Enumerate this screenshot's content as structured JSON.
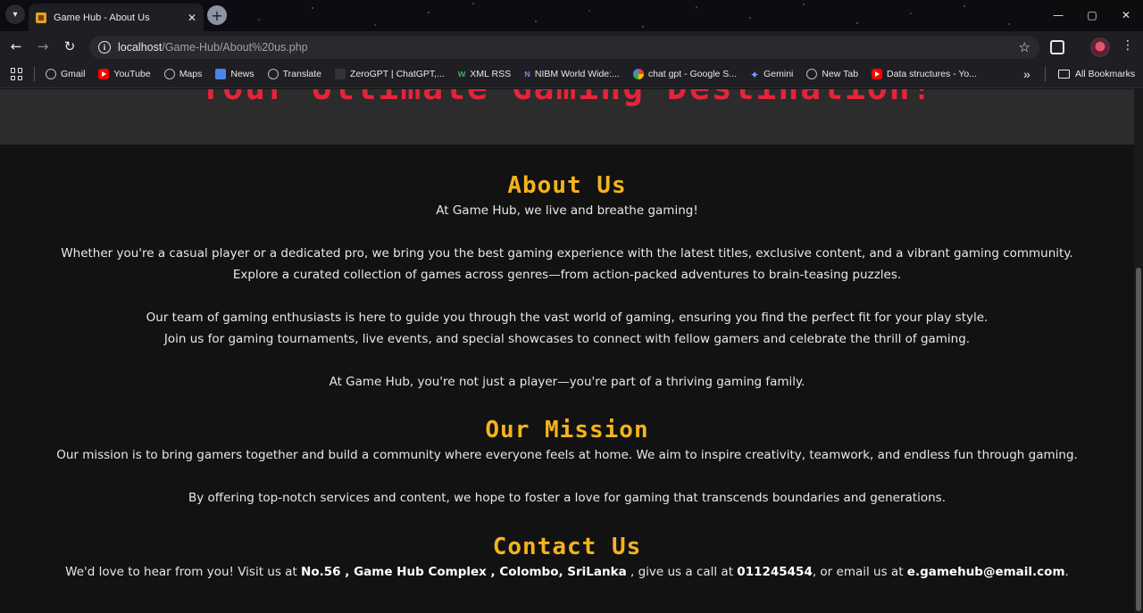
{
  "browser": {
    "tab_title": "Game Hub - About Us",
    "url_host": "localhost",
    "url_path": "/Game-Hub/About%20us.php",
    "bookmarks": [
      {
        "label": "Gmail",
        "icon": "globe-icon"
      },
      {
        "label": "YouTube",
        "icon": "youtube-icon"
      },
      {
        "label": "Maps",
        "icon": "globe-icon"
      },
      {
        "label": "News",
        "icon": "news-icon"
      },
      {
        "label": "Translate",
        "icon": "globe-icon"
      },
      {
        "label": "ZeroGPT | ChatGPT,...",
        "icon": "zerogpt-icon"
      },
      {
        "label": "XML RSS",
        "icon": "xml-icon"
      },
      {
        "label": "NIBM World Wide:...",
        "icon": "nibm-icon"
      },
      {
        "label": "chat gpt - Google S...",
        "icon": "google-icon"
      },
      {
        "label": "Gemini",
        "icon": "gemini-icon"
      },
      {
        "label": "New Tab",
        "icon": "globe-icon"
      },
      {
        "label": "Data structures - Yo...",
        "icon": "youtube-icon"
      }
    ],
    "all_bookmarks_label": "All Bookmarks"
  },
  "page": {
    "hero_title": "Your Ultimate Gaming Destination!",
    "about": {
      "heading": "About Us",
      "lines": [
        "At Game Hub, we live and breathe gaming!",
        "",
        "Whether you're a casual player or a dedicated pro, we bring you the best gaming experience with the latest titles, exclusive content, and a vibrant gaming community.",
        "Explore a curated collection of games across genres—from action-packed adventures to brain-teasing puzzles.",
        "",
        "Our team of gaming enthusiasts is here to guide you through the vast world of gaming, ensuring you find the perfect fit for your play style.",
        "Join us for gaming tournaments, live events, and special showcases to connect with fellow gamers and celebrate the thrill of gaming.",
        "",
        "At Game Hub, you're not just a player—you're part of a thriving gaming family."
      ]
    },
    "mission": {
      "heading": "Our Mission",
      "line1": "Our mission is to bring gamers together and build a community where everyone feels at home. We aim to inspire creativity, teamwork, and endless fun through gaming.",
      "line2": "By offering top-notch services and content, we hope to foster a love for gaming that transcends boundaries and generations."
    },
    "contact": {
      "heading": "Contact Us",
      "prefix": "We'd love to hear from you! Visit us at ",
      "address": "No.56 , Game Hub Complex , Colombo, SriLanka",
      "mid1": " , give us a call at ",
      "phone": "011245454",
      "mid2": ", or email us at ",
      "email": "e.gamehub@email.com",
      "suffix": "."
    }
  },
  "colors": {
    "heading": "#f5b31d",
    "hero_title": "#e3243b",
    "background": "#121212"
  }
}
